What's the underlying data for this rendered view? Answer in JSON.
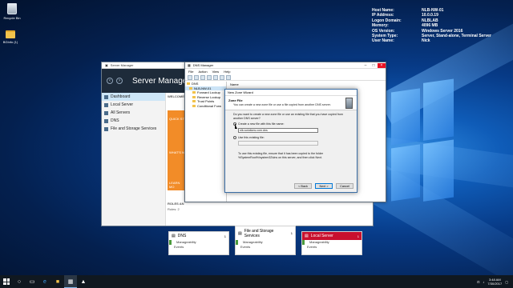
{
  "desktop": {
    "icons": [
      {
        "label": "Recycle Bin"
      },
      {
        "label": "BGInfo (1)"
      }
    ]
  },
  "bginfo": [
    {
      "key": "Host Name:",
      "value": "NLB-NW-01"
    },
    {
      "key": "IP Address:",
      "value": "10.0.0.19"
    },
    {
      "key": "Logon Domain:",
      "value": "NLBLAB"
    },
    {
      "key": "Memory:",
      "value": "4096 MB"
    },
    {
      "key": "OS Version:",
      "value": "Windows Server 2016"
    },
    {
      "key": "System Type:",
      "value": "Server, Stand-alone, Terminal Server"
    },
    {
      "key": "User Name:",
      "value": "Nick"
    }
  ],
  "server_manager": {
    "window_title": "Server Manager",
    "header_title": "Server Manager",
    "sidebar": [
      {
        "label": "Dashboard"
      },
      {
        "label": "Local Server"
      },
      {
        "label": "All Servers"
      },
      {
        "label": "DNS"
      },
      {
        "label": "File and Storage Services"
      }
    ],
    "welcome": "WELCOME",
    "quick_start": [
      "QUICK ST",
      "WHAT'S N",
      "LEARN MO"
    ],
    "roles_heading": "ROLES AN",
    "roles_sub": "Roles: 2",
    "tiles": [
      {
        "title": "DNS",
        "count": "1",
        "rows": [
          "Manageability",
          "Events"
        ]
      },
      {
        "title": "File and Storage Services",
        "count": "1",
        "rows": [
          "Manageability",
          "Events"
        ]
      },
      {
        "title": "Local Server",
        "count": "1",
        "rows": [
          "Manageability",
          "Events"
        ]
      }
    ]
  },
  "dns_manager": {
    "window_title": "DNS Manager",
    "menu": [
      "File",
      "Action",
      "View",
      "Help"
    ],
    "tree": [
      "DNS",
      "NLB-NW-01",
      "Forward Lookup",
      "Reverse Lookup",
      "Trust Points",
      "Conditional Forw"
    ],
    "right_header": "Name"
  },
  "wizard": {
    "title": "New Zone Wizard",
    "heading": "Zone File",
    "subheading": "You can create a new zone file or use a file copied from another DNS server.",
    "question": "Do you want to create a new zone file or use an existing file that you have copied from another DNS server?",
    "option_new": "Create a new file with this file name:",
    "filename_value": "nlb-solutions.com.dns",
    "option_existing": "Use this existing file:",
    "note": "To use this existing file, ensure that it has been copied to the folder %SystemRoot%\\system32\\dns on this server, and then click Next.",
    "btn_back": "< Back",
    "btn_next": "Next >",
    "btn_cancel": "Cancel"
  },
  "taskbar": {
    "time": "3:48 AM",
    "date": "7/30/2017"
  }
}
